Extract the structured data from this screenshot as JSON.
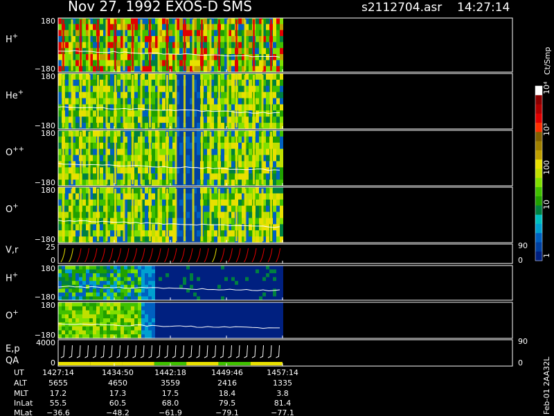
{
  "header": {
    "title": "Nov 27, 1992    EXOS-D SMS",
    "file": "s2112704.asr",
    "time": "14:27:14"
  },
  "chart_data": {
    "type": "heatmap",
    "panels": [
      {
        "label": "H",
        "sup": "+",
        "ymax_label": "180",
        "ymin_label": "−180"
      },
      {
        "label": "He",
        "sup": "+",
        "ymax_label": "180",
        "ymin_label": "−180"
      },
      {
        "label": "O",
        "sup": "++",
        "ymax_label": "180",
        "ymin_label": "−180"
      },
      {
        "label": "O",
        "sup": "+",
        "ymax_label": "180",
        "ymin_label": "−180"
      },
      {
        "label": "V,r",
        "sup": "",
        "ymax_label": "25",
        "ymin_label": "0",
        "right_top": "90",
        "right_bottom": "0"
      },
      {
        "label": "H",
        "sup": "+",
        "ymax_label": "180",
        "ymin_label": "−180"
      },
      {
        "label": "O",
        "sup": "+",
        "ymax_label": "180",
        "ymin_label": "−180"
      },
      {
        "label": "E,p",
        "label2": "QA",
        "sup": "",
        "ymax_label": "4000",
        "ymin_label": "0",
        "right_top": "90",
        "right_bottom": "0"
      }
    ],
    "colorbar": {
      "unit": "Ct/Smp",
      "labels": [
        "10⁴",
        "10³",
        "100",
        "10",
        "1"
      ],
      "colors": [
        "#ffffff",
        "#8b0000",
        "#b00000",
        "#e00000",
        "#ff3000",
        "#806000",
        "#a08000",
        "#c0a000",
        "#e8e000",
        "#c0e000",
        "#80e000",
        "#40c000",
        "#20a000",
        "#008040",
        "#00c0c0",
        "#00a0d0",
        "#0060c0",
        "#0040a0",
        "#002080"
      ]
    },
    "time_table": {
      "row_labels": [
        "UT",
        "ALT",
        "MLT",
        "InLat",
        "MLat"
      ],
      "columns": [
        [
          "1427:14",
          "5655",
          "17.2",
          "55.5",
          "−36.6"
        ],
        [
          "1434:50",
          "4650",
          "17.3",
          "60.5",
          "−48.2"
        ],
        [
          "1442:18",
          "3559",
          "17.5",
          "68.0",
          "−61.9"
        ],
        [
          "1449:46",
          "2416",
          "18.4",
          "79.5",
          "−79.1"
        ],
        [
          "1457:14",
          "1335",
          "3.8",
          "81.4",
          "−77.1"
        ]
      ]
    },
    "footer_code": "Feb-01 2AA32L"
  }
}
